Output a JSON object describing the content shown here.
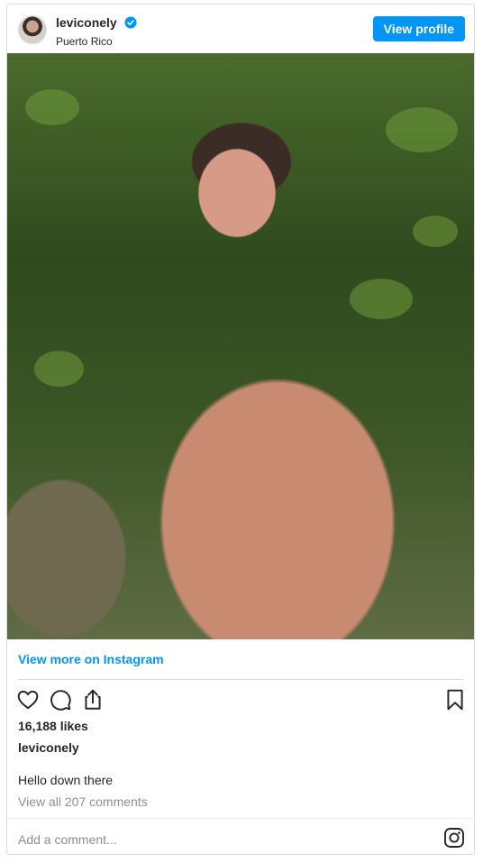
{
  "post": {
    "username": "leviconely",
    "location": "Puerto Rico",
    "view_profile_label": "View profile",
    "view_more_label": "View more on Instagram",
    "likes": "16,188 likes",
    "owner_username": "leviconely",
    "caption": "Hello down there",
    "comments_link": "View all 207 comments",
    "add_comment_placeholder": "Add a comment..."
  },
  "icons": {
    "verified": "verified-badge-icon",
    "like": "heart-icon",
    "comment": "comment-bubble-icon",
    "share": "share-icon",
    "save": "bookmark-icon",
    "brand": "instagram-logo-icon"
  },
  "colors": {
    "accent": "#0095f6",
    "text": "#262626",
    "muted": "#8e8e8e",
    "border": "#dbdbdb"
  }
}
